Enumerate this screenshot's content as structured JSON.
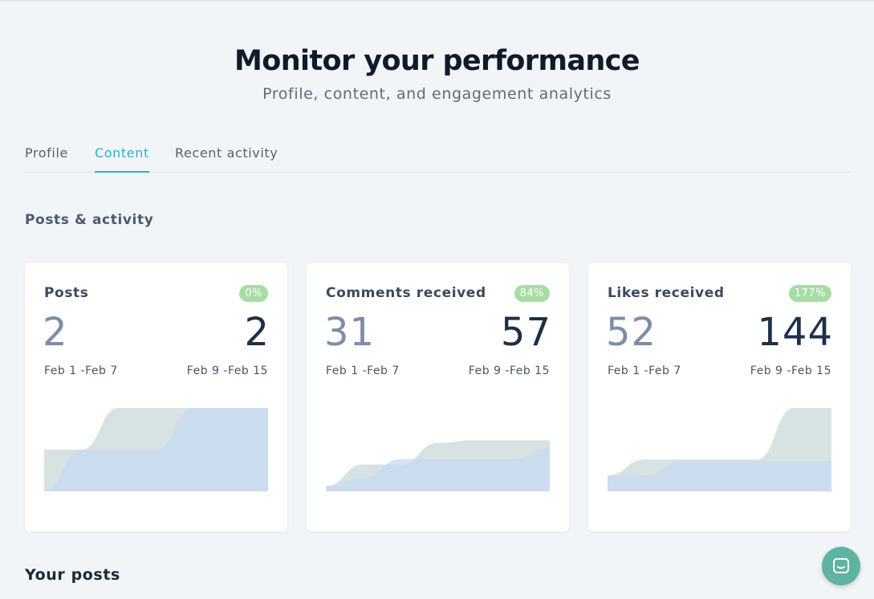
{
  "header": {
    "title": "Monitor your performance",
    "subtitle": "Profile, content, and engagement analytics"
  },
  "tabs": [
    {
      "label": "Profile",
      "active": false
    },
    {
      "label": "Content",
      "active": true
    },
    {
      "label": "Recent activity",
      "active": false
    }
  ],
  "section": {
    "title": "Posts & activity"
  },
  "cards": [
    {
      "title": "Posts",
      "badge": "0%",
      "prev_value": "2",
      "cur_value": "2",
      "prev_range": "Feb 1 -Feb 7",
      "cur_range": "Feb 9 -Feb 15"
    },
    {
      "title": "Comments received",
      "badge": "84%",
      "prev_value": "31",
      "cur_value": "57",
      "prev_range": "Feb 1 -Feb 7",
      "cur_range": "Feb 9 -Feb 15"
    },
    {
      "title": "Likes received",
      "badge": "177%",
      "prev_value": "52",
      "cur_value": "144",
      "prev_range": "Feb 1 -Feb 7",
      "cur_range": "Feb 9 -Feb 15"
    }
  ],
  "your_posts": {
    "title": "Your posts"
  },
  "colors": {
    "accent": "#26b5c5",
    "badge": "#a8dca5",
    "prev_area": "#c9d9d8",
    "cur_area": "#c6d8f4",
    "chat_button": "#5fb3a3"
  },
  "icons": {
    "chat": "chat-bubble-icon"
  },
  "chart_data": [
    {
      "type": "area",
      "series": [
        {
          "values": [
            1,
            1,
            2,
            2,
            2,
            2,
            2
          ]
        },
        {
          "values": [
            0,
            1,
            1,
            1,
            2,
            2,
            2
          ]
        }
      ],
      "ylim": [
        0,
        2
      ]
    },
    {
      "type": "area",
      "series": [
        {
          "values": [
            2,
            10,
            10,
            18,
            19,
            19,
            19
          ]
        },
        {
          "values": [
            2,
            5,
            12,
            12,
            12,
            12,
            16
          ]
        }
      ],
      "ylim": [
        0,
        31
      ]
    },
    {
      "type": "area",
      "series": [
        {
          "values": [
            9,
            18,
            18,
            18,
            18,
            47,
            47
          ]
        },
        {
          "values": [
            9,
            9,
            17,
            17,
            17,
            17,
            17
          ]
        }
      ],
      "ylim": [
        0,
        47
      ]
    }
  ]
}
